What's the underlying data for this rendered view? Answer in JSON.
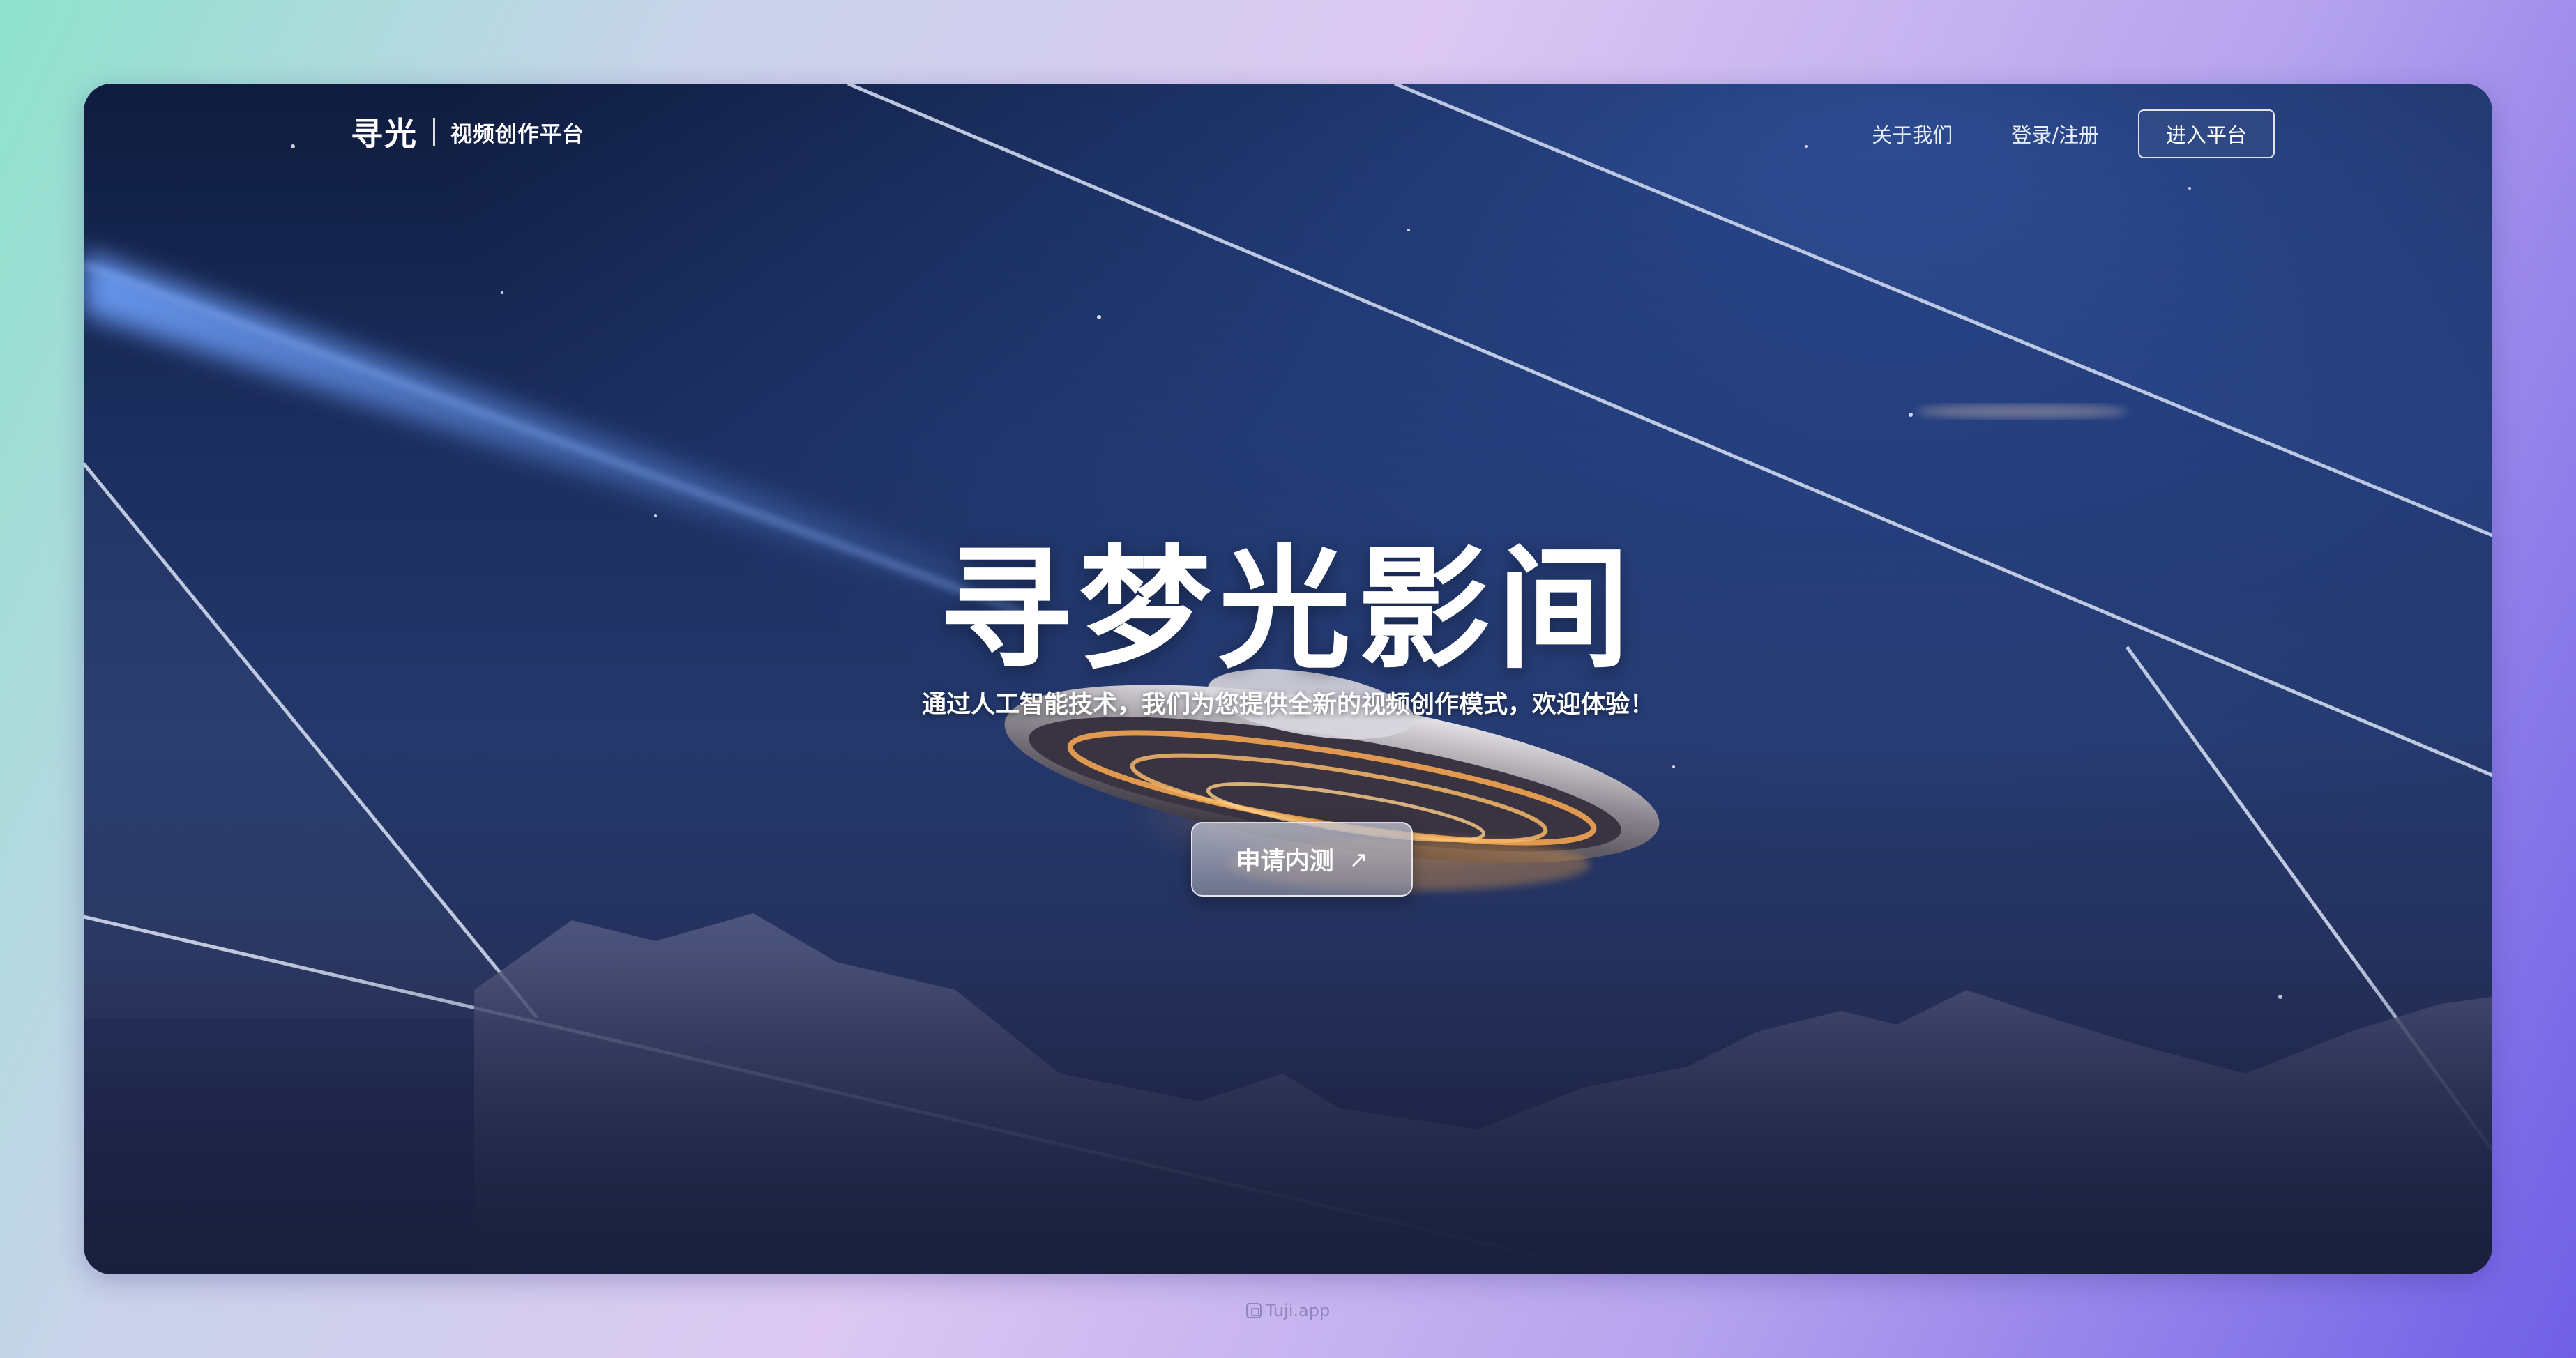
{
  "header": {
    "logo_text": "寻光",
    "platform_name": "视频创作平台",
    "nav_links": [
      "关于我们",
      "登录/注册"
    ],
    "enter_button": "进入平台"
  },
  "hero": {
    "title": "寻梦光影间",
    "subtitle": "通过人工智能技术，我们为您提供全新的视频创作模式，欢迎体验！",
    "cta_label": "申请内测",
    "cta_icon": "arrow-up-right-icon"
  },
  "watermark": {
    "text": "Tuji.app"
  },
  "colors": {
    "frame_top": "#0f1c3e",
    "frame_mid": "#24386c",
    "backdrop_left": "#8ee3cc",
    "backdrop_right": "#6f5fe6",
    "beam": "#5f8ee8",
    "saucer_glow": "#f0a24a"
  }
}
